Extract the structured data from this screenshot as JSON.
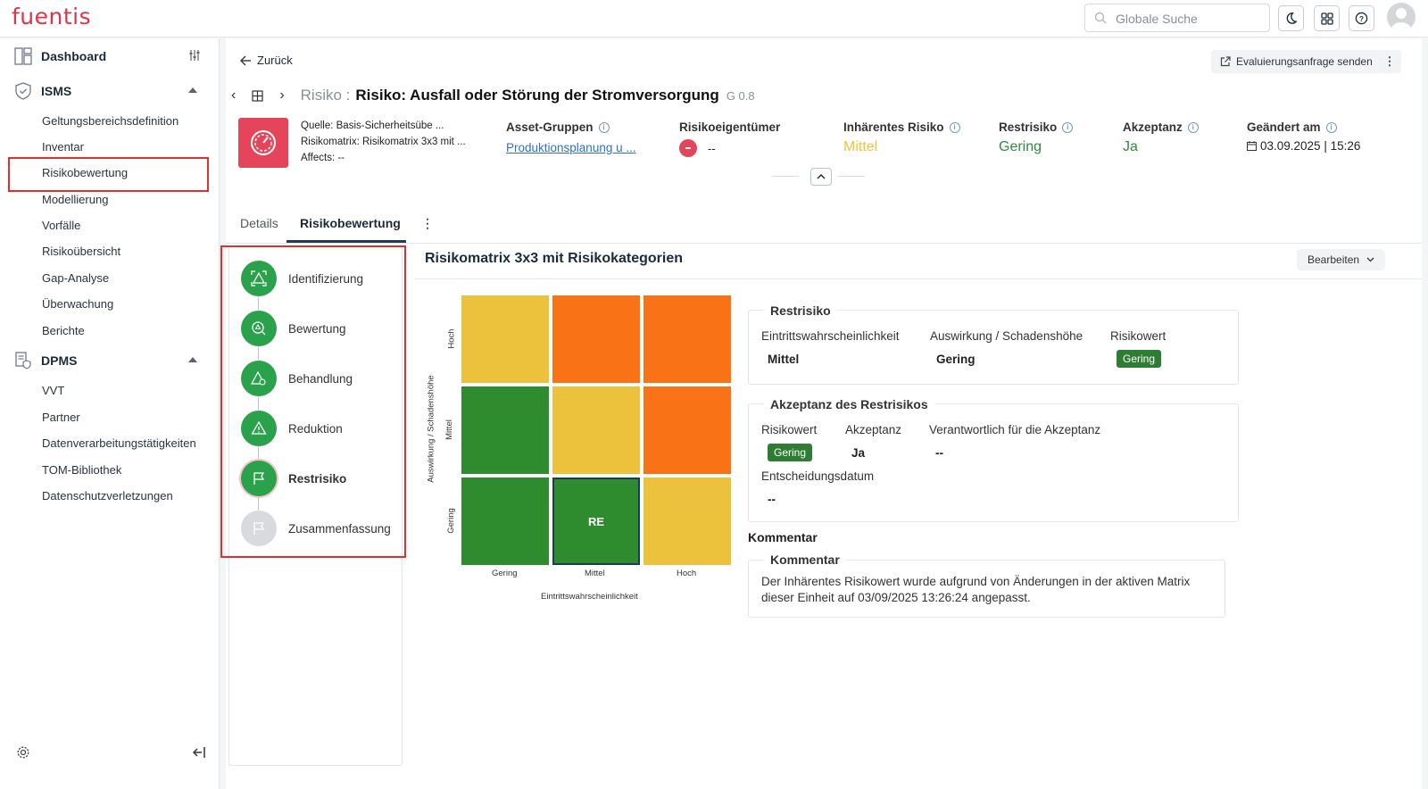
{
  "app": {
    "logo": "fuentis"
  },
  "search": {
    "placeholder": "Globale Suche"
  },
  "sidebar": {
    "dashboard": "Dashboard",
    "isms": {
      "label": "ISMS",
      "items": [
        "Geltungsbereichsdefinition",
        "Inventar",
        "Risikobewertung",
        "Modellierung",
        "Vorfälle",
        "Risikoübersicht",
        "Gap-Analyse",
        "Überwachung",
        "Berichte"
      ]
    },
    "dpms": {
      "label": "DPMS",
      "items": [
        "VVT",
        "Partner",
        "Datenverarbeitungstätigkeiten",
        "TOM-Bibliothek",
        "Datenschutzverletzungen"
      ]
    }
  },
  "header": {
    "back": "Zurück",
    "eval_button": "Evaluierungsanfrage senden",
    "title_prefix": "Risiko :",
    "title": "Risiko: Ausfall oder Störung der Stromversorgung",
    "version": "G 0.8",
    "meta": {
      "quelle": "Quelle: Basis-Sicherheitsübe ...",
      "matrix": "Risikomatrix: Risikomatrix 3x3 mit ...",
      "affects": "Affects: --"
    },
    "asset_groups": {
      "label": "Asset-Gruppen",
      "value": "Produktionsplanung u ..."
    },
    "owner": {
      "label": "Risikoeigentümer",
      "value": "--"
    },
    "inherent": {
      "label": "Inhärentes Risiko",
      "value": "Mittel",
      "color": "#f0c33c"
    },
    "residual": {
      "label": "Restrisiko",
      "value": "Gering",
      "color": "#2e8b3e"
    },
    "acceptance": {
      "label": "Akzeptanz",
      "value": "Ja",
      "color": "#2e8b3e"
    },
    "changed": {
      "label": "Geändert am",
      "value": "03.09.2025 | 15:26"
    }
  },
  "tabs": [
    "Details",
    "Risikobewertung"
  ],
  "steps": [
    "Identifizierung",
    "Bewertung",
    "Behandlung",
    "Reduktion",
    "Restrisiko",
    "Zusammenfassung"
  ],
  "matrix": {
    "title": "Risikomatrix 3x3 mit Risikokategorien",
    "edit_button": "Bearbeiten",
    "y_axis": "Auswirkung / Schadenshöhe",
    "x_axis": "Eintrittswahrscheinlichkeit",
    "rows": [
      "Hoch",
      "Mittel",
      "Gering"
    ],
    "cols": [
      "Gering",
      "Mittel",
      "Hoch"
    ],
    "marker": "RE",
    "colors": {
      "yellow": "#ecc13b",
      "orange": "#f97316",
      "green": "#2e8b2e"
    }
  },
  "residual_panel": {
    "title": "Restrisiko",
    "probability_label": "Eintrittswahrscheinlichkeit",
    "probability": "Mittel",
    "impact_label": "Auswirkung / Schadenshöhe",
    "impact": "Gering",
    "risk_label": "Risikowert",
    "risk": "Gering"
  },
  "acceptance_panel": {
    "title": "Akzeptanz des Restrisikos",
    "risk_label": "Risikowert",
    "risk": "Gering",
    "acceptance_label": "Akzeptanz",
    "acceptance": "Ja",
    "responsible_label": "Verantwortlich für die Akzeptanz",
    "responsible": "--",
    "date_label": "Entscheidungsdatum",
    "date": "--"
  },
  "comment": {
    "section": "Kommentar",
    "title": "Kommentar",
    "line1": "Der Inhärentes Risikowert wurde aufgrund von Änderungen in der aktiven Matrix",
    "line2": "dieser Einheit auf 03/09/2025 13:26:24 angepasst."
  }
}
